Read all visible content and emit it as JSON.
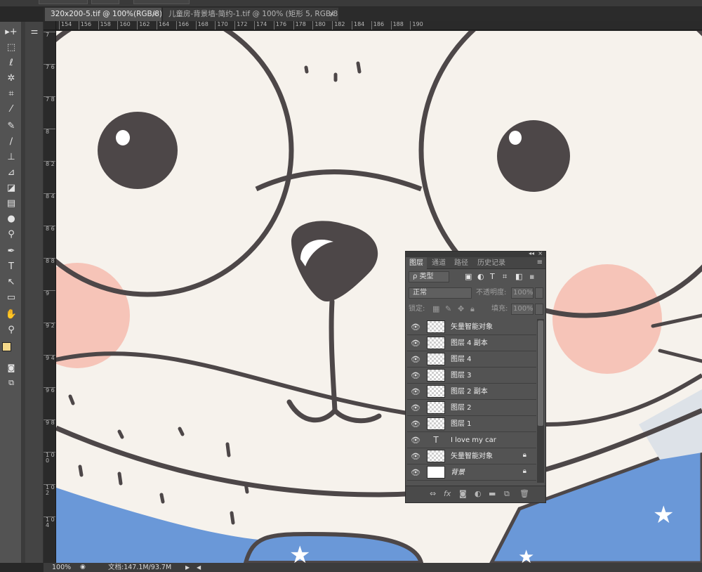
{
  "window": {
    "tabs": [
      {
        "label": "320x200-5.tif @ 100%(RGB/8)",
        "active": true
      },
      {
        "label": "儿童房-背景墙-简约-1.tif @ 100% (矩形 5, RGB/8) *",
        "active": false
      }
    ],
    "close_glyph": "×"
  },
  "rulers": {
    "horizontal": [
      "154",
      "156",
      "158",
      "160",
      "162",
      "164",
      "166",
      "168",
      "170",
      "172",
      "174",
      "176",
      "178",
      "180",
      "182",
      "184",
      "186",
      "188",
      "190"
    ],
    "vertical": [
      "7",
      "7 6",
      "7 8",
      "8",
      "8 2",
      "8 4",
      "8 6",
      "8 8",
      "9",
      "9 2",
      "9 4",
      "9 6",
      "9 8",
      "1 0 0",
      "1 0 2",
      "1 0 4"
    ]
  },
  "tools": [
    "move-icon",
    "marquee-icon",
    "lasso-icon",
    "magic-wand-icon",
    "crop-icon",
    "eyedropper-icon",
    "healing-brush-icon",
    "brush-icon",
    "clone-stamp-icon",
    "history-brush-icon",
    "eraser-icon",
    "gradient-icon",
    "blur-icon",
    "dodge-icon",
    "pen-icon",
    "type-icon",
    "path-select-icon",
    "shape-icon",
    "hand-icon",
    "zoom-icon"
  ],
  "colors": {
    "foreground": "#f4d88a",
    "background": "#000000",
    "canvas_bg": "#f6f2ec",
    "line": "#4d4748",
    "blush": "#f6bfb3",
    "scarf": "#6a98d8"
  },
  "layers_panel": {
    "tabs": [
      "图层",
      "通道",
      "路径",
      "历史记录"
    ],
    "filter_label": "ρ 类型",
    "blend_mode": "正常",
    "opacity_label": "不透明度:",
    "opacity_value": "100%",
    "lock_label": "锁定:",
    "fill_label": "填充:",
    "fill_value": "100%",
    "layers": [
      {
        "name": "矢量智能对象",
        "thumb": "smart",
        "locked": false,
        "italic": false
      },
      {
        "name": "图层 4 副本",
        "thumb": "transparent",
        "locked": false,
        "italic": false
      },
      {
        "name": "图层 4",
        "thumb": "transparent",
        "locked": false,
        "italic": false
      },
      {
        "name": "图层 3",
        "thumb": "transparent",
        "locked": false,
        "italic": false
      },
      {
        "name": "图层 2 副本",
        "thumb": "transparent",
        "locked": false,
        "italic": false
      },
      {
        "name": "图层 2",
        "thumb": "transparent",
        "locked": false,
        "italic": false
      },
      {
        "name": "图层 1",
        "thumb": "transparent",
        "locked": false,
        "italic": false
      },
      {
        "name": "I love my car",
        "thumb": "text",
        "locked": false,
        "italic": false
      },
      {
        "name": "矢量智能对象",
        "thumb": "smart",
        "locked": true,
        "italic": false
      },
      {
        "name": "背景",
        "thumb": "white",
        "locked": true,
        "italic": true
      }
    ],
    "footer_icons": [
      "link-icon",
      "fx-icon",
      "mask-icon",
      "adjustment-icon",
      "folder-icon",
      "new-layer-icon",
      "trash-icon"
    ]
  },
  "status": {
    "zoom": "100%",
    "doc_info": "文档:147.1M/93.7M"
  }
}
